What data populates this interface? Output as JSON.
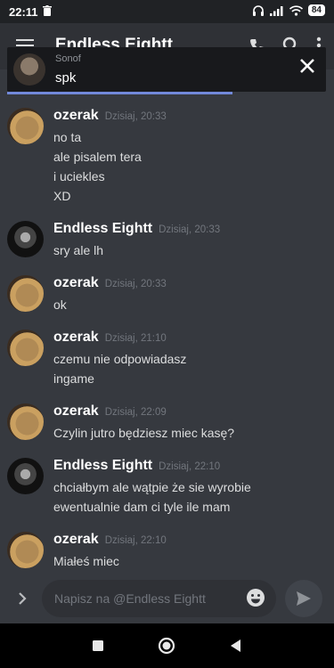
{
  "status_bar": {
    "time": "22:11",
    "battery": "84"
  },
  "header": {
    "title": "Endless Eightt"
  },
  "notification": {
    "sender": "Sonof",
    "preview": "spk"
  },
  "messages": [
    {
      "author": "ozerak",
      "avatar": "ozerak",
      "timestamp": "Dzisiaj, 20:33",
      "lines": [
        "no ta",
        "ale pisalem tera",
        "i uciekles",
        "XD"
      ]
    },
    {
      "author": "Endless Eightt",
      "avatar": "endless",
      "timestamp": "Dzisiaj, 20:33",
      "lines": [
        "sry ale lh"
      ]
    },
    {
      "author": "ozerak",
      "avatar": "ozerak",
      "timestamp": "Dzisiaj, 20:33",
      "lines": [
        "ok"
      ]
    },
    {
      "author": "ozerak",
      "avatar": "ozerak",
      "timestamp": "Dzisiaj, 21:10",
      "lines": [
        "czemu nie odpowiadasz",
        "ingame"
      ]
    },
    {
      "author": "ozerak",
      "avatar": "ozerak",
      "timestamp": "Dzisiaj, 22:09",
      "lines": [
        "Czylin jutro będziesz miec kasę?"
      ]
    },
    {
      "author": "Endless Eightt",
      "avatar": "endless",
      "timestamp": "Dzisiaj, 22:10",
      "lines": [
        "chciałbym ale wątpie że sie wyrobie",
        "ewentualnie dam ci tyle ile mam"
      ]
    },
    {
      "author": "ozerak",
      "avatar": "ozerak",
      "timestamp": "Dzisiaj, 22:10",
      "lines": [
        "Miałeś miec"
      ]
    }
  ],
  "composer": {
    "placeholder": "Napisz na @Endless Eightt",
    "value": ""
  },
  "colors": {
    "background": "#36393f",
    "accent": "#7289da",
    "author": "#ffffff",
    "timestamp": "#72767d"
  },
  "icons": [
    "trash-icon",
    "headphones-icon",
    "signal-icon",
    "wifi-icon",
    "battery-icon",
    "hamburger-icon",
    "at-icon",
    "call-icon",
    "search-icon",
    "more-icon",
    "close-icon",
    "chevron-right-icon",
    "emoji-icon",
    "send-icon",
    "nav-recents-icon",
    "nav-home-icon",
    "nav-back-icon"
  ]
}
